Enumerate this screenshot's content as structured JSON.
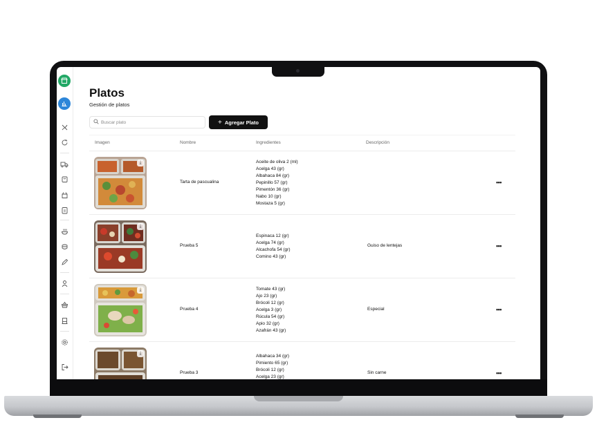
{
  "page": {
    "title": "Platos",
    "subtitle": "Gestión de platos",
    "search_placeholder": "Buscar plato",
    "add_button_label": "Agregar Plato"
  },
  "sidebar": {
    "icons": [
      {
        "name": "store-icon",
        "accent": "#22a866"
      },
      {
        "name": "chart-icon",
        "accent": "#2d86d9"
      },
      {
        "name": "route-icon"
      },
      {
        "name": "refresh-icon"
      },
      {
        "name": "truck-icon"
      },
      {
        "name": "bag-icon"
      },
      {
        "name": "box-icon"
      },
      {
        "name": "clipboard-icon"
      },
      {
        "name": "bowl-icon"
      },
      {
        "name": "dish-icon"
      },
      {
        "name": "pen-icon"
      },
      {
        "name": "user-icon"
      },
      {
        "name": "basket-icon"
      },
      {
        "name": "register-icon"
      },
      {
        "name": "settings-icon"
      },
      {
        "name": "logout-icon"
      }
    ]
  },
  "table": {
    "columns": [
      "Imagen",
      "Nombre",
      "Ingredientes",
      "Descripción"
    ],
    "rows": [
      {
        "name": "Tarta de pascualina",
        "ingredients": [
          "Aceite de oliva 2 (ml)",
          "Acelga 43 (gr)",
          "Albahaca 84 (gr)",
          "Pepinillo 57 (gr)",
          "Pimentón 36 (gr)",
          "Nabo 10 (gr)",
          "Mostaza 5 (gr)"
        ],
        "description": ""
      },
      {
        "name": "Prueba 5",
        "ingredients": [
          "Espinaca 12 (gr)",
          "Acelga 74 (gr)",
          "Alcachofa 54 (gr)",
          "Comino 43 (gr)"
        ],
        "description": "Guiso de lentejas"
      },
      {
        "name": "Prueba 4",
        "ingredients": [
          "Tomate 43 (gr)",
          "Ajo 23 (gr)",
          "Brócoli 12 (gr)",
          "Acelga 3 (gr)",
          "Rúcula 54 (gr)",
          "Apio 32 (gr)",
          "Azafrán 43 (gr)"
        ],
        "description": "Especial"
      },
      {
        "name": "Prueba 3",
        "ingredients": [
          "Albahaca 34 (gr)",
          "Pimiento 65 (gr)",
          "Brócoli 12 (gr)",
          "Acelga 23 (gr)"
        ],
        "description": "Sin carne"
      }
    ],
    "more_label": "•••"
  }
}
